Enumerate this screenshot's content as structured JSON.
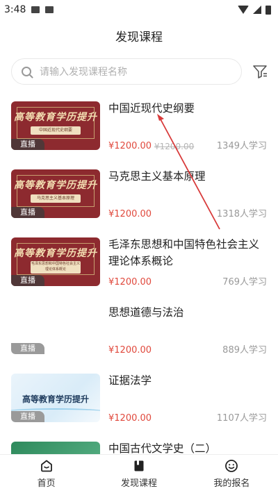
{
  "status_bar": {
    "time": "3:48"
  },
  "header": {
    "title": "发现课程"
  },
  "search": {
    "placeholder": "请输入发现课程名称"
  },
  "courses": [
    {
      "title": "中国近现代史纲要",
      "price": "¥1200.00",
      "original_price": "¥1200.00",
      "learners": "1349人学习",
      "tag": "直播",
      "banner_title": "高等教育学历提升",
      "banner_sub": "中国近现代史纲要"
    },
    {
      "title": "马克思主义基本原理",
      "price": "¥1200.00",
      "learners": "1318人学习",
      "tag": "直播",
      "banner_title": "高等教育学历提升",
      "banner_sub": "马克思主义基本原理"
    },
    {
      "title": "毛泽东思想和中国特色社会主义理论体系概论",
      "price": "¥1200.00",
      "learners": "769人学习",
      "tag": "直播",
      "banner_title": "高等教育学历提升",
      "banner_sub": "毛泽东思想和中国特色社会主义理论体系概论"
    },
    {
      "title": "思想道德与法治",
      "price": "¥1200.00",
      "learners": "889人学习",
      "tag": "直播"
    },
    {
      "title": "证据法学",
      "price": "¥1200.00",
      "learners": "1107人学习",
      "tag": "直播",
      "banner_title": "高等教育学历提升"
    },
    {
      "title": "中国古代文学史（二）"
    }
  ],
  "tabbar": {
    "home": "首页",
    "discover": "发现课程",
    "my_signup": "我的报名"
  },
  "colors": {
    "price": "#e0483c",
    "banner_red": "#8d2a2f",
    "annotation_arrow": "#d83a3a"
  }
}
